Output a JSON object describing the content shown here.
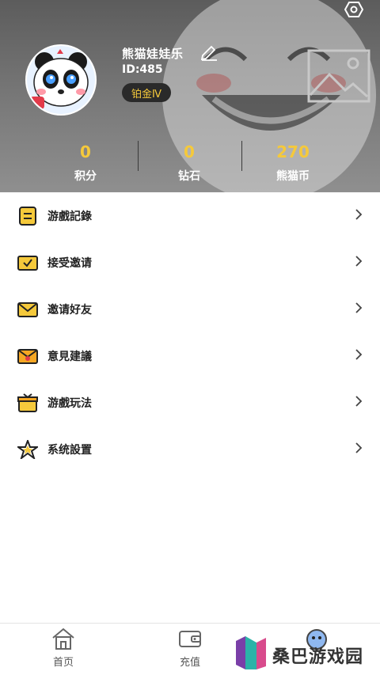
{
  "profile": {
    "nickname": "熊猫娃娃乐",
    "id_text": "ID:485",
    "level": "铂金Ⅳ"
  },
  "stats": [
    {
      "value": "0",
      "label": "积分"
    },
    {
      "value": "0",
      "label": "钻石"
    },
    {
      "value": "270",
      "label": "熊猫币"
    }
  ],
  "menu": [
    {
      "label": "游戲記錄",
      "icon": "list-icon"
    },
    {
      "label": "接受邀请",
      "icon": "envelope-check-icon"
    },
    {
      "label": "邀请好友",
      "icon": "envelope-icon"
    },
    {
      "label": "意見建議",
      "icon": "feedback-envelope-icon"
    },
    {
      "label": "游戲玩法",
      "icon": "gift-box-icon"
    },
    {
      "label": "系统設置",
      "icon": "star-settings-icon"
    }
  ],
  "tabs": [
    {
      "label": "首页",
      "icon": "home-icon"
    },
    {
      "label": "充值",
      "icon": "wallet-icon"
    }
  ],
  "watermark": {
    "text": "桑巴游戏园"
  },
  "colors": {
    "accent": "#f5c93b",
    "header_bg": "#6b6b6b",
    "badge_bg": "#2a2a2a"
  }
}
